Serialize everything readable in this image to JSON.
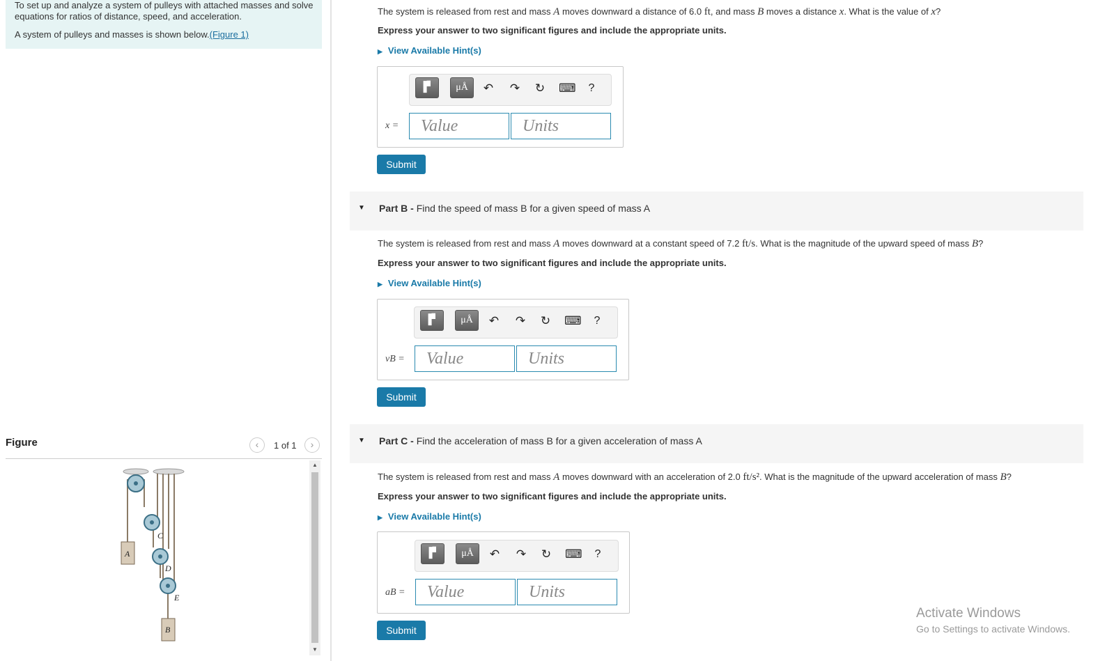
{
  "intro": {
    "learning_goal": "To set up and analyze a system of pulleys with attached masses and solve equations for ratios of distance, speed, and acceleration.",
    "system_text": "A system of pulleys and masses is shown below.",
    "figure_link": "(Figure 1)"
  },
  "figure": {
    "title": "Figure",
    "counter": "1 of 1",
    "labels": {
      "A": "A",
      "B": "B",
      "C": "C",
      "D": "D",
      "E": "E"
    }
  },
  "part_a": {
    "question_pre": "The system is released from rest and mass ",
    "var_a": "A",
    "question_mid": " moves downward a distance of 6.0 ",
    "unit": "ft",
    "question_mid2": ", and mass ",
    "var_b": "B",
    "question_mid3": " moves a distance ",
    "var_x": "x",
    "question_mid4": ". What is the value of ",
    "var_x2": "x",
    "question_end": "?",
    "instruction": "Express your answer to two significant figures and include the appropriate units.",
    "hint": "View Available Hint(s)",
    "var_label": "x =",
    "value_placeholder": "Value",
    "units_placeholder": "Units",
    "submit": "Submit"
  },
  "part_b": {
    "title_bold": "Part B - ",
    "title": "Find the speed of mass B for a given speed of mass A",
    "question_pre": "The system is released from rest and mass ",
    "var_a": "A",
    "question_mid": " moves downward at a constant speed of 7.2 ",
    "unit": "ft/s",
    "question_mid2": ". What is the magnitude of the upward speed of mass ",
    "var_b": "B",
    "question_end": "?",
    "instruction": "Express your answer to two significant figures and include the appropriate units.",
    "hint": "View Available Hint(s)",
    "var_label": "vB =",
    "value_placeholder": "Value",
    "units_placeholder": "Units",
    "submit": "Submit"
  },
  "part_c": {
    "title_bold": "Part C - ",
    "title": "Find the acceleration of mass B for a given acceleration of mass A",
    "question_pre": "The system is released from rest and mass ",
    "var_a": "A",
    "question_mid": " moves downward with an acceleration of 2.0 ",
    "unit": "ft/s²",
    "question_mid2": ". What is the magnitude of the upward acceleration of mass ",
    "var_b": "B",
    "question_end": "?",
    "instruction": "Express your answer to two significant figures and include the appropriate units.",
    "hint": "View Available Hint(s)",
    "var_label": "aB =",
    "value_placeholder": "Value",
    "units_placeholder": "Units",
    "submit": "Submit"
  },
  "toolbar": {
    "templates_label": "▐▘",
    "units_btn": "μÅ",
    "undo": "↶",
    "redo": "↷",
    "reset": "↻",
    "keyboard": "⌨",
    "help": "?"
  },
  "watermark": {
    "line1": "Activate Windows",
    "line2": "Go to Settings to activate Windows."
  }
}
